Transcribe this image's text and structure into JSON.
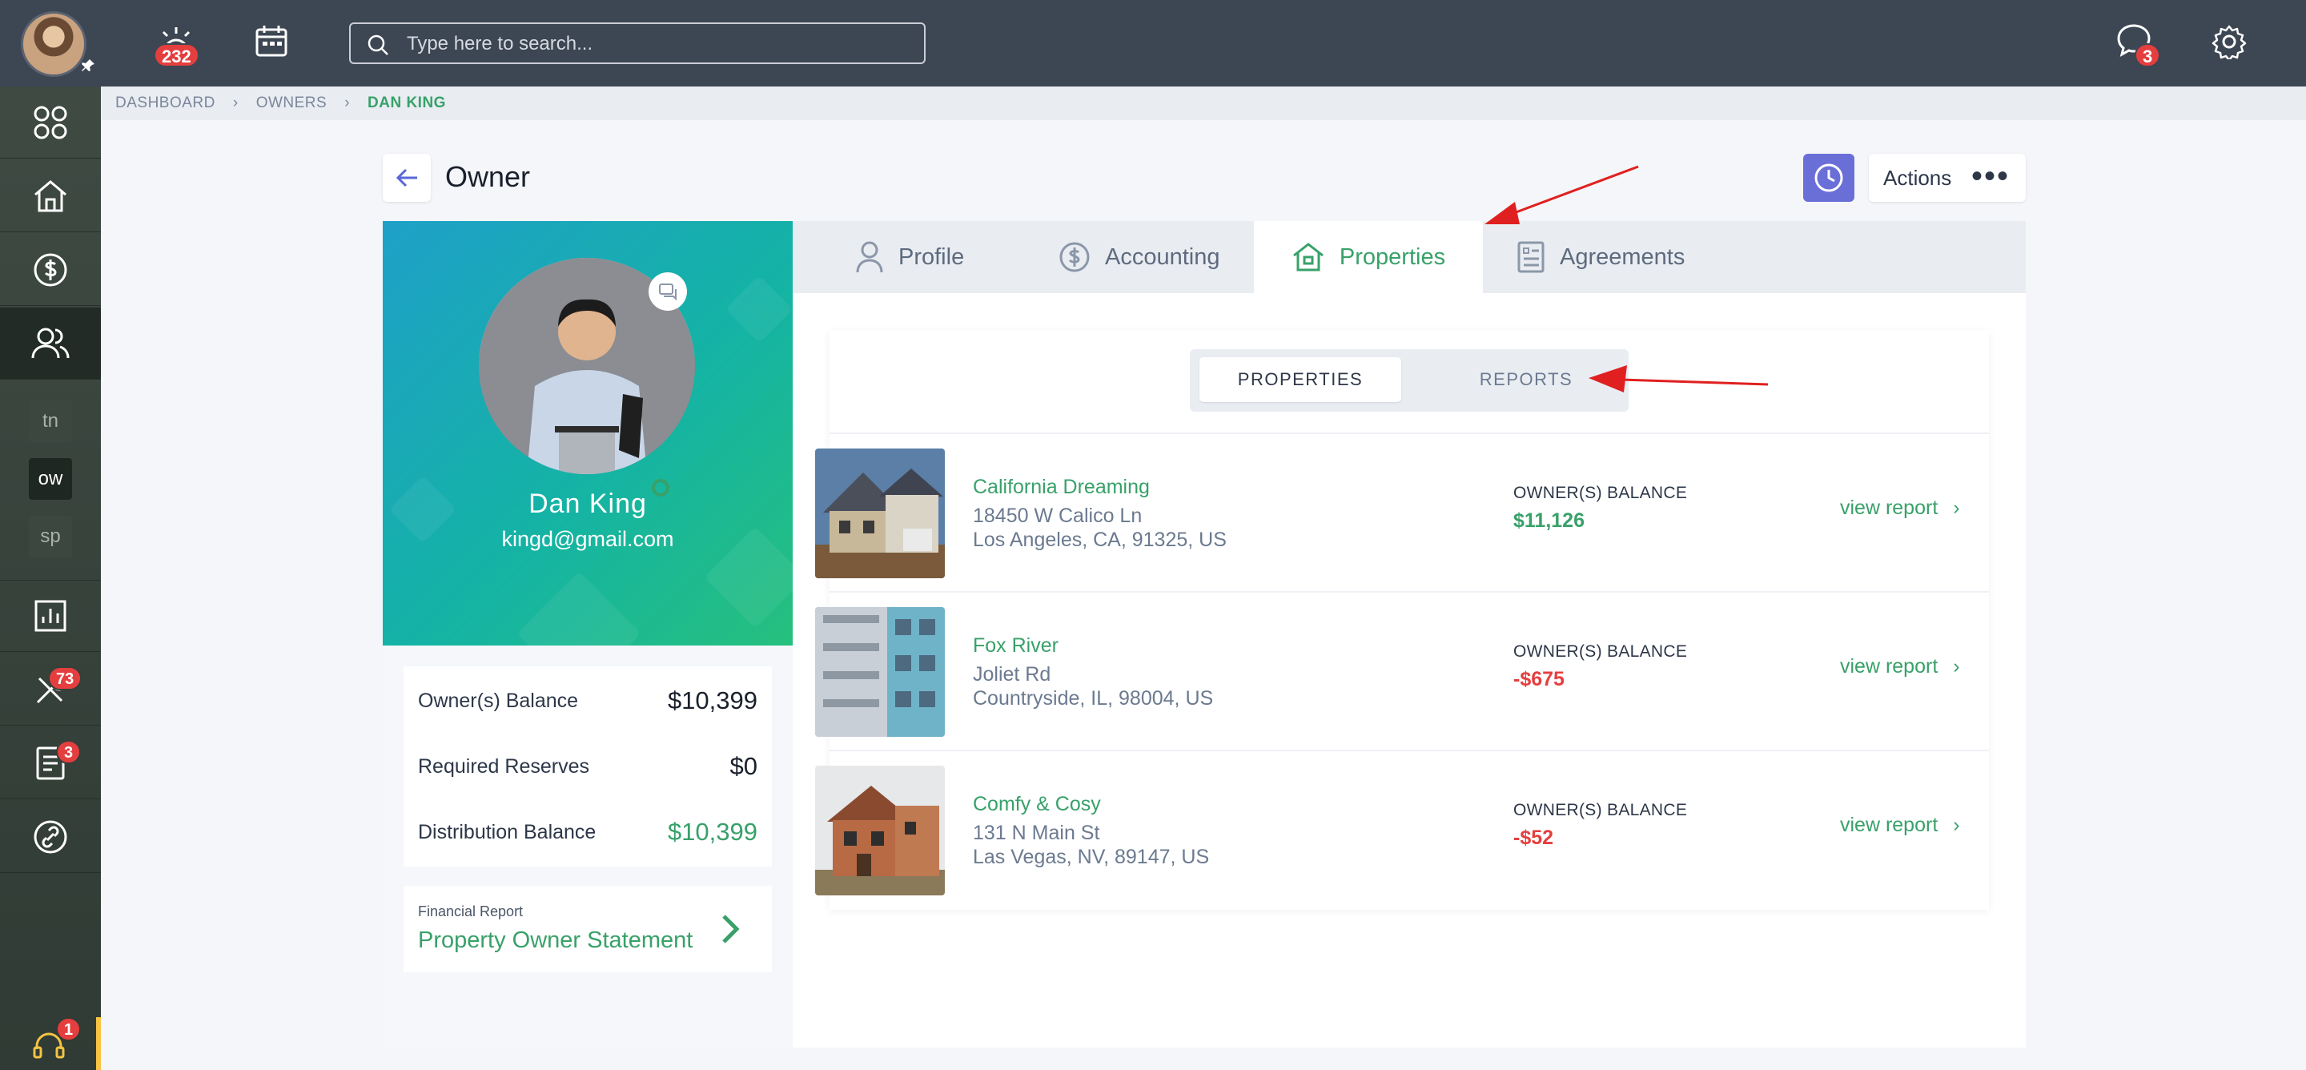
{
  "topbar": {
    "alerts_badge": "232",
    "search_placeholder": "Type here to search...",
    "messages_badge": "3"
  },
  "sidebar": {
    "tools_badge": "73",
    "docs_badge": "3",
    "support_badge": "1",
    "apps": [
      "tn",
      "ow",
      "sp"
    ]
  },
  "breadcrumb": [
    "DASHBOARD",
    "OWNERS",
    "DAN KING"
  ],
  "header": {
    "title": "Owner",
    "actions_label": "Actions"
  },
  "profile": {
    "name": "Dan King",
    "email": "kingd@gmail.com"
  },
  "balances": [
    {
      "label": "Owner(s) Balance",
      "value": "$10,399"
    },
    {
      "label": "Required Reserves",
      "value": "$0"
    },
    {
      "label": "Distribution Balance",
      "value": "$10,399"
    }
  ],
  "financial_report": {
    "small": "Financial Report",
    "title": "Property Owner Statement"
  },
  "tabs": [
    "Profile",
    "Accounting",
    "Properties",
    "Agreements"
  ],
  "segment": [
    "PROPERTIES",
    "REPORTS"
  ],
  "properties": [
    {
      "name": "California Dreaming",
      "addr1": "18450 W Calico Ln",
      "addr2": "Los Angeles, CA, 91325, US",
      "balance_label": "OWNER(S) BALANCE",
      "balance": "$11,126",
      "link": "view report"
    },
    {
      "name": "Fox River",
      "addr1": "Joliet Rd",
      "addr2": "Countryside, IL, 98004, US",
      "balance_label": "OWNER(S) BALANCE",
      "balance": "-$675",
      "link": "view report"
    },
    {
      "name": "Comfy & Cosy",
      "addr1": "131 N Main St",
      "addr2": "Las Vegas, NV, 89147, US",
      "balance_label": "OWNER(S) BALANCE",
      "balance": "-$52",
      "link": "view report"
    }
  ],
  "colors": {
    "accent_green": "#38a169",
    "negative_red": "#e53e3e",
    "topbar": "#3d4653",
    "clock_button": "#6a6fd8"
  }
}
